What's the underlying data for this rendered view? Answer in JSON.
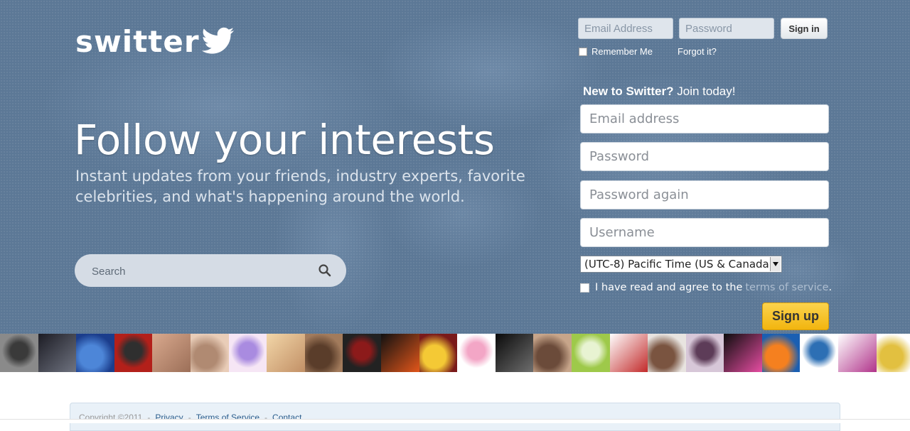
{
  "brand": {
    "logo_text": "switter",
    "logo_icon": "bird-icon"
  },
  "signin": {
    "email_placeholder": "Email Address",
    "password_placeholder": "Password",
    "button_label": "Sign in",
    "remember_label": "Remember Me",
    "forgot_label": "Forgot it?"
  },
  "hero": {
    "headline": "Follow your interests",
    "subline": "Instant updates from your friends, industry experts, favorite celebrities, and what's happening around the world."
  },
  "search": {
    "placeholder": "Search",
    "icon": "search-icon"
  },
  "signup": {
    "title_bold": "New to Switter?",
    "title_rest": " Join today!",
    "email_placeholder": "Email address",
    "password_placeholder": "Password",
    "password_again_placeholder": "Password again",
    "username_placeholder": "Username",
    "timezone_selected": "(UTC-8) Pacific Time (US & Canada)",
    "terms_prefix": "I have read and agree to the",
    "terms_link": "terms of service",
    "terms_suffix": ".",
    "button_label": "Sign up"
  },
  "avatars": [
    {
      "name": "avatar-1",
      "colors": [
        "#8a8a8a",
        "#3a3a3a"
      ]
    },
    {
      "name": "avatar-2",
      "colors": [
        "#1c1c24",
        "#6f7380"
      ]
    },
    {
      "name": "avatar-3",
      "colors": [
        "#1b3d8c",
        "#4d86d8"
      ]
    },
    {
      "name": "avatar-4",
      "colors": [
        "#b3201a",
        "#2f2f2f"
      ]
    },
    {
      "name": "avatar-5",
      "colors": [
        "#d9a98e",
        "#9c6f58"
      ]
    },
    {
      "name": "avatar-6",
      "colors": [
        "#e9cdb8",
        "#b08a72"
      ]
    },
    {
      "name": "avatar-7",
      "colors": [
        "#f6e6f5",
        "#a98be0"
      ]
    },
    {
      "name": "avatar-8",
      "colors": [
        "#f2d6a8",
        "#c29066"
      ]
    },
    {
      "name": "avatar-9",
      "colors": [
        "#a27b5c",
        "#5a3d2a"
      ]
    },
    {
      "name": "avatar-10",
      "colors": [
        "#222222",
        "#8c1a1a"
      ]
    },
    {
      "name": "avatar-11",
      "colors": [
        "#111111",
        "#e2561a"
      ]
    },
    {
      "name": "avatar-12",
      "colors": [
        "#7a1a1a",
        "#f4c935"
      ]
    },
    {
      "name": "avatar-13",
      "colors": [
        "#ffffff",
        "#f3a6c6"
      ]
    },
    {
      "name": "avatar-14",
      "colors": [
        "#0a0a0a",
        "#6e6e6e"
      ]
    },
    {
      "name": "avatar-15",
      "colors": [
        "#c7a58a",
        "#6b4b3a"
      ]
    },
    {
      "name": "avatar-16",
      "colors": [
        "#9ec94a",
        "#e8f3d2"
      ]
    },
    {
      "name": "avatar-17",
      "colors": [
        "#ffffff",
        "#c22a2a"
      ]
    },
    {
      "name": "avatar-18",
      "colors": [
        "#e8e4e0",
        "#7a5440"
      ]
    },
    {
      "name": "avatar-19",
      "colors": [
        "#d7c7d8",
        "#5d3c58"
      ]
    },
    {
      "name": "avatar-20",
      "colors": [
        "#0d0d0d",
        "#e64da2"
      ]
    },
    {
      "name": "avatar-21",
      "colors": [
        "#1a5fb2",
        "#f5801f"
      ]
    },
    {
      "name": "avatar-22",
      "colors": [
        "#ffffff",
        "#2d6fb4"
      ]
    },
    {
      "name": "avatar-23",
      "colors": [
        "#ffffff",
        "#b0338a"
      ]
    },
    {
      "name": "avatar-24",
      "colors": [
        "#ffffff",
        "#e2c040"
      ]
    }
  ],
  "footer": {
    "copyright": "Copyright ©2011",
    "links": [
      "Privacy",
      "Terms of Service",
      "Contact"
    ]
  },
  "colors": {
    "hero_bg": "#5c7896",
    "signup_button": "#f2b50f",
    "link": "#2b5d8c"
  }
}
